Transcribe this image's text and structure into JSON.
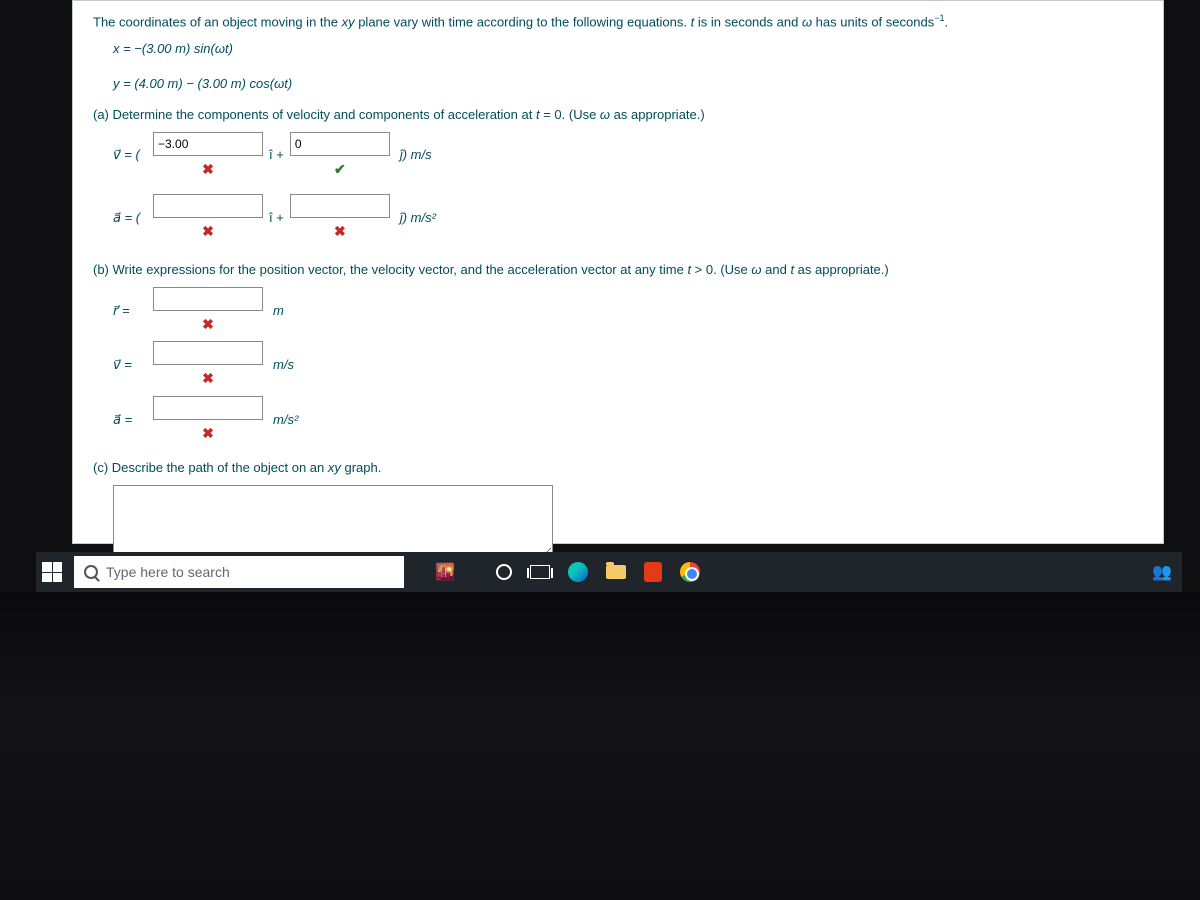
{
  "problem": {
    "intro_before": "The coordinates of an object moving in the ",
    "intro_xy": "xy",
    "intro_mid": " plane vary with time according to the following equations. ",
    "intro_t": "t",
    "intro_mid2": " is in seconds and ",
    "intro_omega": "ω",
    "intro_end": " has units of seconds",
    "intro_exp": "−1",
    "intro_period": ".",
    "eq_x": "x = −(3.00 m) sin(ωt)",
    "eq_y": "y = (4.00 m) − (3.00 m) cos(ωt)"
  },
  "partA": {
    "prompt_before": "(a) Determine the components of velocity and components of acceleration at ",
    "prompt_t": "t",
    "prompt_mid": " = 0. (Use ",
    "prompt_omega": "ω",
    "prompt_end": " as appropriate.)",
    "v_label": "v⃗ = (",
    "v_i_value": "−3.00",
    "i_plus": "î +",
    "v_j_value": "0",
    "v_unit": "ĵ) m/s",
    "a_label": "a⃗ = (",
    "a_i_value": "",
    "a_j_value": "",
    "a_unit": "ĵ) m/s²",
    "mark_x": "✖",
    "mark_check": "✔"
  },
  "partB": {
    "prompt_before": "(b) Write expressions for the position vector, the velocity vector, and the acceleration vector at any time ",
    "prompt_t": "t",
    "prompt_mid": " > 0. (Use ",
    "prompt_omega": "ω",
    "prompt_and": " and ",
    "prompt_t2": "t",
    "prompt_end": " as appropriate.)",
    "r_label": "r⃗ =",
    "r_value": "",
    "r_unit": "m",
    "v_label": "v⃗ =",
    "v_value": "",
    "v_unit": "m/s",
    "a_label": "a⃗ =",
    "a_value": "",
    "a_unit": "m/s²"
  },
  "partC": {
    "prompt_before": "(c) Describe the path of the object on an ",
    "prompt_xy": "xy",
    "prompt_end": " graph.",
    "value": ""
  },
  "taskbar": {
    "search_placeholder": "Type here to search"
  }
}
